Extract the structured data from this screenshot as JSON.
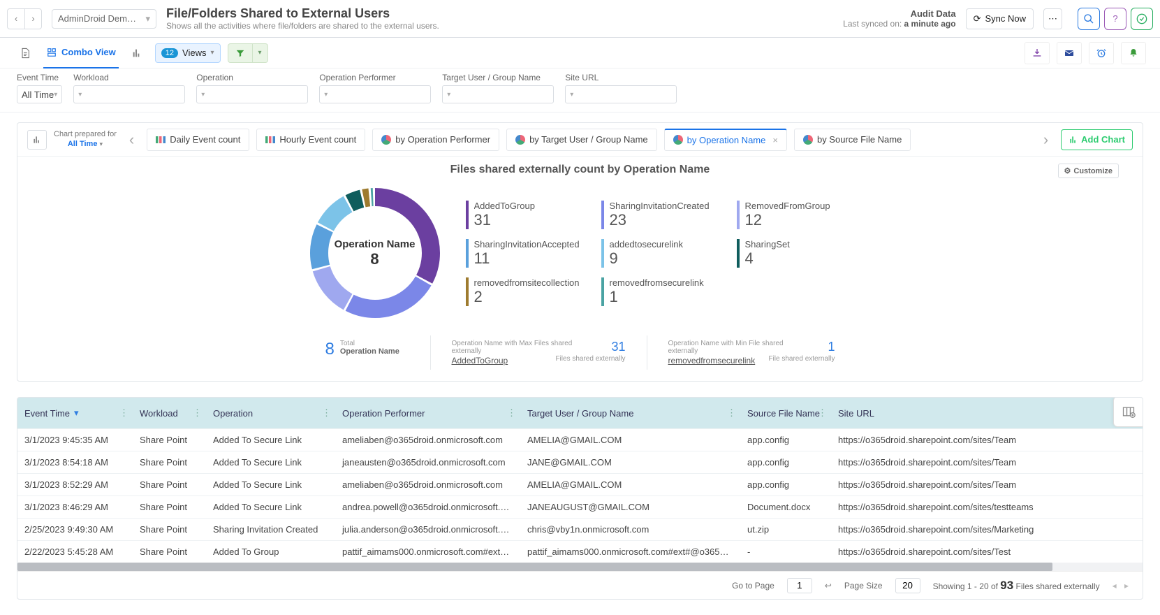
{
  "header": {
    "org": "AdminDroid Dem…",
    "title": "File/Folders Shared to External Users",
    "subtitle": "Shows all the activities where file/folders are shared to the external users.",
    "audit": "Audit Data",
    "synced_pre": "Last synced on: ",
    "synced_val": "a minute ago",
    "sync_btn": "Sync Now"
  },
  "toolbar": {
    "combo": "Combo View",
    "views_count": "12",
    "views": "Views"
  },
  "filters": {
    "f1": "Event Time",
    "f1v": "All Time",
    "f2": "Workload",
    "f3": "Operation",
    "f4": "Operation Performer",
    "f5": "Target User / Group Name",
    "f6": "Site URL"
  },
  "chart": {
    "prep1": "Chart prepared for",
    "prep2": "All Time",
    "tabs": [
      "Daily Event count",
      "Hourly Event count",
      "by Operation Performer",
      "by Target User / Group Name",
      "by Operation Name",
      "by Source File Name"
    ],
    "active": 4,
    "addchart": "Add Chart",
    "title": "Files shared externally count by Operation Name",
    "customize": "Customize",
    "center1": "Operation Name",
    "center2": "8",
    "stats": {
      "total_n": "8",
      "total_l1": "Total",
      "total_l2": "Operation Name",
      "max_l": "Operation Name with Max Files shared externally",
      "max_link": "AddedToGroup",
      "max_n": "31",
      "max_sub": "Files shared externally",
      "min_l": "Operation Name with Min File shared externally",
      "min_link": "removedfromsecurelink",
      "min_n": "1",
      "min_sub": "File shared externally"
    }
  },
  "chart_data": {
    "type": "pie",
    "title": "Files shared externally count by Operation Name",
    "series": [
      {
        "name": "AddedToGroup",
        "value": 31,
        "color": "#6b3fa0"
      },
      {
        "name": "SharingInvitationCreated",
        "value": 23,
        "color": "#7b87e8"
      },
      {
        "name": "RemovedFromGroup",
        "value": 12,
        "color": "#9fa8ef"
      },
      {
        "name": "SharingInvitationAccepted",
        "value": 11,
        "color": "#5aa0dc"
      },
      {
        "name": "addedtosecurelink",
        "value": 9,
        "color": "#7cc3e8"
      },
      {
        "name": "SharingSet",
        "value": 4,
        "color": "#0f5d5d"
      },
      {
        "name": "removedfromsitecollection",
        "value": 2,
        "color": "#9e7b2f"
      },
      {
        "name": "removedfromsecurelink",
        "value": 1,
        "color": "#4aa3a3"
      }
    ],
    "total": 93
  },
  "table": {
    "cols": [
      "Event Time",
      "Workload",
      "Operation",
      "Operation Performer",
      "Target User / Group Name",
      "Source File Name",
      "Site URL"
    ],
    "rows": [
      [
        "3/1/2023 9:45:35 AM",
        "Share Point",
        "Added To Secure Link",
        "ameliaben@o365droid.onmicrosoft.com",
        "AMELIA@GMAIL.COM",
        "app.config",
        "https://o365droid.sharepoint.com/sites/Team"
      ],
      [
        "3/1/2023 8:54:18 AM",
        "Share Point",
        "Added To Secure Link",
        "janeausten@o365droid.onmicrosoft.com",
        "JANE@GMAIL.COM",
        "app.config",
        "https://o365droid.sharepoint.com/sites/Team"
      ],
      [
        "3/1/2023 8:52:29 AM",
        "Share Point",
        "Added To Secure Link",
        "ameliaben@o365droid.onmicrosoft.com",
        "AMELIA@GMAIL.COM",
        "app.config",
        "https://o365droid.sharepoint.com/sites/Team"
      ],
      [
        "3/1/2023 8:46:29 AM",
        "Share Point",
        "Added To Secure Link",
        "andrea.powell@o365droid.onmicrosoft.c…",
        "JANEAUGUST@GMAIL.COM",
        "Document.docx",
        "https://o365droid.sharepoint.com/sites/testteams"
      ],
      [
        "2/25/2023 9:49:30 AM",
        "Share Point",
        "Sharing Invitation Created",
        "julia.anderson@o365droid.onmicrosoft.c…",
        "chris@vby1n.onmicrosoft.com",
        "ut.zip",
        "https://o365droid.sharepoint.com/sites/Marketing"
      ],
      [
        "2/22/2023 5:45:28 AM",
        "Share Point",
        "Added To Group",
        "pattif_aimams000.onmicrosoft.com#ext#…",
        "pattif_aimams000.onmicrosoft.com#ext#@o365d…",
        "-",
        "https://o365droid.sharepoint.com/sites/Test"
      ]
    ]
  },
  "pager": {
    "goto": "Go to Page",
    "goto_v": "1",
    "size": "Page Size",
    "size_v": "20",
    "show_a": "Showing 1 - 20 of ",
    "show_n": "93",
    "show_b": " Files shared externally"
  }
}
